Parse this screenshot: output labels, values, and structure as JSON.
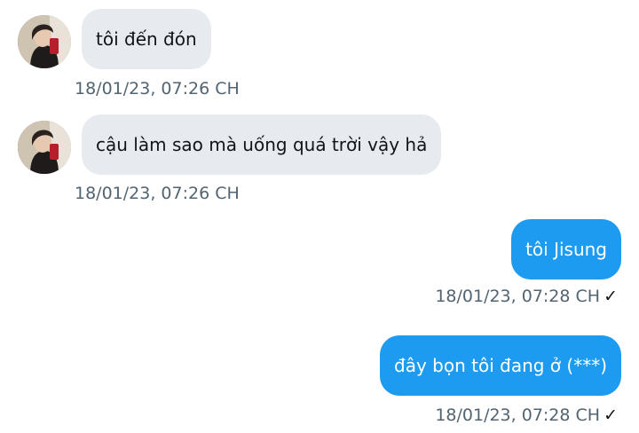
{
  "messages": [
    {
      "direction": "incoming",
      "text": "tôi đến đón",
      "timestamp": "18/01/23,  07:26 CH"
    },
    {
      "direction": "incoming",
      "text": "cậu làm sao mà uống quá trời vậy hả",
      "timestamp": "18/01/23,  07:26 CH"
    },
    {
      "direction": "outgoing",
      "text": "tôi Jisung",
      "timestamp": "18/01/23,  07:28 CH",
      "status": "✓"
    },
    {
      "direction": "outgoing",
      "text": "đây bọn tôi đang ở (***)",
      "timestamp": "18/01/23,  07:28 CH",
      "status": "✓"
    }
  ],
  "colors": {
    "incoming_bubble": "#e7ebef",
    "outgoing_bubble": "#1d9bf0",
    "meta_text": "#536471"
  },
  "icons": {
    "avatar": "user-avatar",
    "read_status": "check-icon"
  }
}
